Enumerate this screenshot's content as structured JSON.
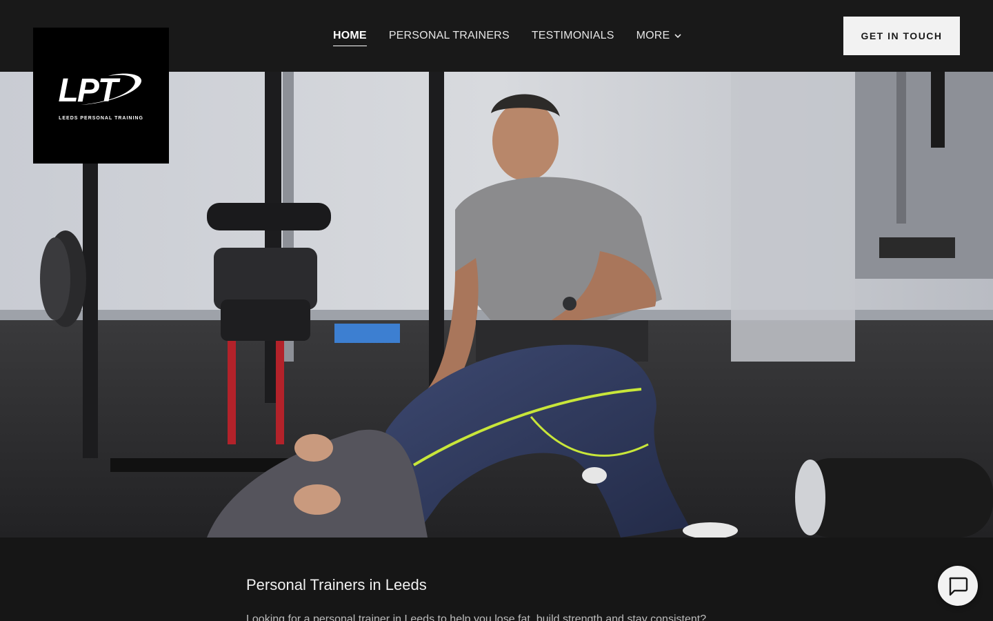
{
  "brand": {
    "logo_letters": "LPT",
    "logo_tagline": "LEEDS PERSONAL TRAINING"
  },
  "nav": {
    "items": [
      {
        "label": "HOME",
        "active": true
      },
      {
        "label": "PERSONAL TRAINERS",
        "active": false
      },
      {
        "label": "TESTIMONIALS",
        "active": false
      },
      {
        "label": "MORE",
        "active": false,
        "icon": "chevron-down-icon"
      }
    ],
    "cta_label": "GET IN TOUCH"
  },
  "hero": {
    "image_alt": "Personal trainer coaching a client doing a glute bridge in a gym"
  },
  "main": {
    "section_title": "Personal Trainers in Leeds",
    "section_text": "Looking for a personal trainer in Leeds to help you lose fat, build strength and stay consistent?"
  },
  "chat": {
    "icon": "chat-bubble-icon"
  },
  "colors": {
    "header_bg": "#191919",
    "page_bg": "#161616",
    "cta_bg": "#f2f2f2",
    "legging_accent": "#c8e63a"
  }
}
